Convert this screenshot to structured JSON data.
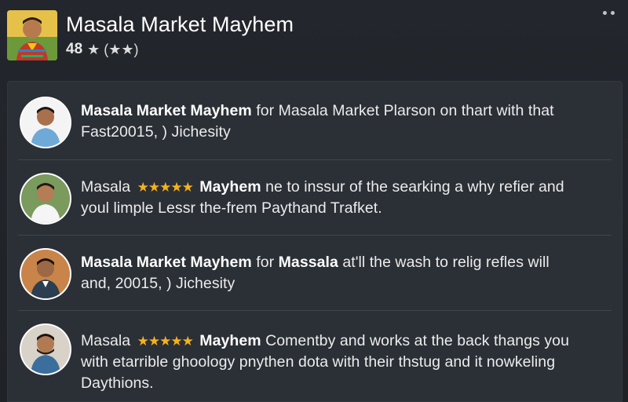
{
  "app": {
    "title": "Masala Market Mayhem",
    "rating_count": "48",
    "rating_star": "★",
    "rating_extra": "(★★)",
    "icon": "app-icon-portrait",
    "more_icon": "more-icon"
  },
  "colors": {
    "background": "#1f2227",
    "panel": "#2b2f36",
    "divider": "#41454d",
    "star": "#f5b21b",
    "text": "#ececec"
  },
  "reviews": [
    {
      "avatar": "avatar-icon",
      "bold_lead": "Masala Market Mayhem",
      "plain_lead": "",
      "stars": "",
      "bold_mid": "",
      "text": " for Masala Market Plarson on thart with that",
      "line2": "Fast20015, ) Jichesity"
    },
    {
      "avatar": "avatar-icon",
      "bold_lead": "",
      "plain_lead": "Masala ",
      "stars": "★★★★★",
      "bold_mid": " Mayhem",
      "text": " ne to inssur of the searking a why refier and",
      "line2": "youl limple Lessr the-frem Paythand Trafket."
    },
    {
      "avatar": "avatar-icon",
      "bold_lead": "Masala Market Mayhem",
      "plain_lead": "",
      "stars": "",
      "bold_mid": "",
      "text": " for ",
      "bold_tail": "Massala",
      "text2": " at'll the wash to relig refles will",
      "line2": "and, 20015, ) Jichesity"
    },
    {
      "avatar": "avatar-icon",
      "bold_lead": "",
      "plain_lead": "Masala ",
      "stars": "★★★★★",
      "bold_mid": " Mayhem",
      "text": " Comentby and works at the back thangs you",
      "line2": "with etarrible ghoology pnythen dota with their thstug and it nowkeling",
      "line3": "Daythions."
    }
  ]
}
